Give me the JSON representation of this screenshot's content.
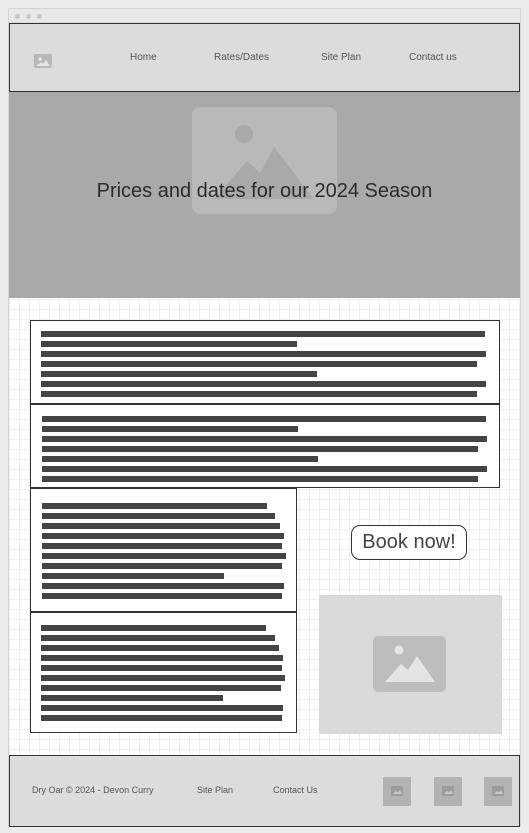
{
  "nav": {
    "home": "Home",
    "rates_dates": "Rates/Dates",
    "site_plan": "Site Plan",
    "contact": "Contact us"
  },
  "hero": {
    "title": "Prices and dates for our 2024 Season",
    "image_icon": "image-placeholder-icon"
  },
  "cta": {
    "book_label": "Book now!"
  },
  "footer": {
    "copyright": "Dry Oar © 2024 - Devon Curry",
    "site_plan": "Site Plan",
    "contact": "Contact Us",
    "social_icons": [
      "image-placeholder-icon",
      "image-placeholder-icon",
      "image-placeholder-icon"
    ]
  },
  "colors": {
    "header_bg": "#dcdcdc",
    "hero_bg": "#a9a9a9",
    "placeholder_text_bar": "#444444",
    "image_placeholder": "#d9d9d9"
  }
}
